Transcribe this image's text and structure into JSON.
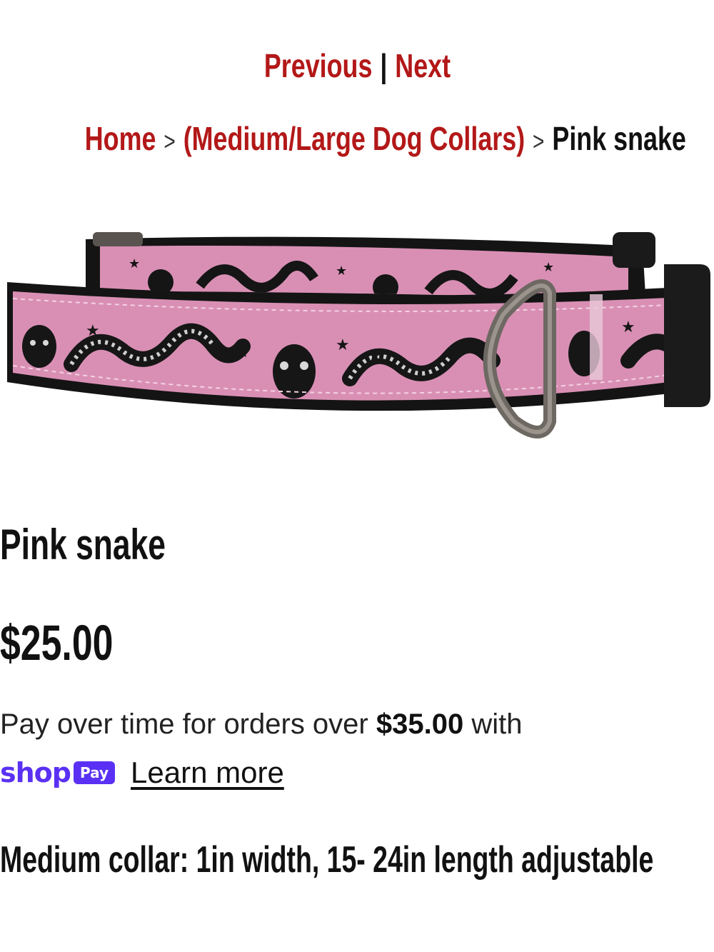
{
  "pager": {
    "previous_label": "Previous",
    "separator": "|",
    "next_label": "Next"
  },
  "breadcrumb": {
    "home_label": "Home",
    "separator": ">",
    "category_label": "(Medium/Large Dog Collars)",
    "current_label": "Pink snake"
  },
  "product": {
    "title": "Pink snake",
    "price": "$25.00",
    "image_alt_icon": "dog-collar-image",
    "description": "Medium collar: 1in width, 15- 24in length adjustable"
  },
  "installments": {
    "text_before": "Pay over time for orders over ",
    "threshold": "$35.00",
    "text_after": " with",
    "shop_word": "shop",
    "pay_badge": "Pay",
    "learn_more": "Learn more"
  },
  "colors": {
    "link_red": "#b31818",
    "shop_pay_purple": "#5a31f4",
    "collar_pink": "#d98fb4",
    "webbing_black": "#141414"
  }
}
